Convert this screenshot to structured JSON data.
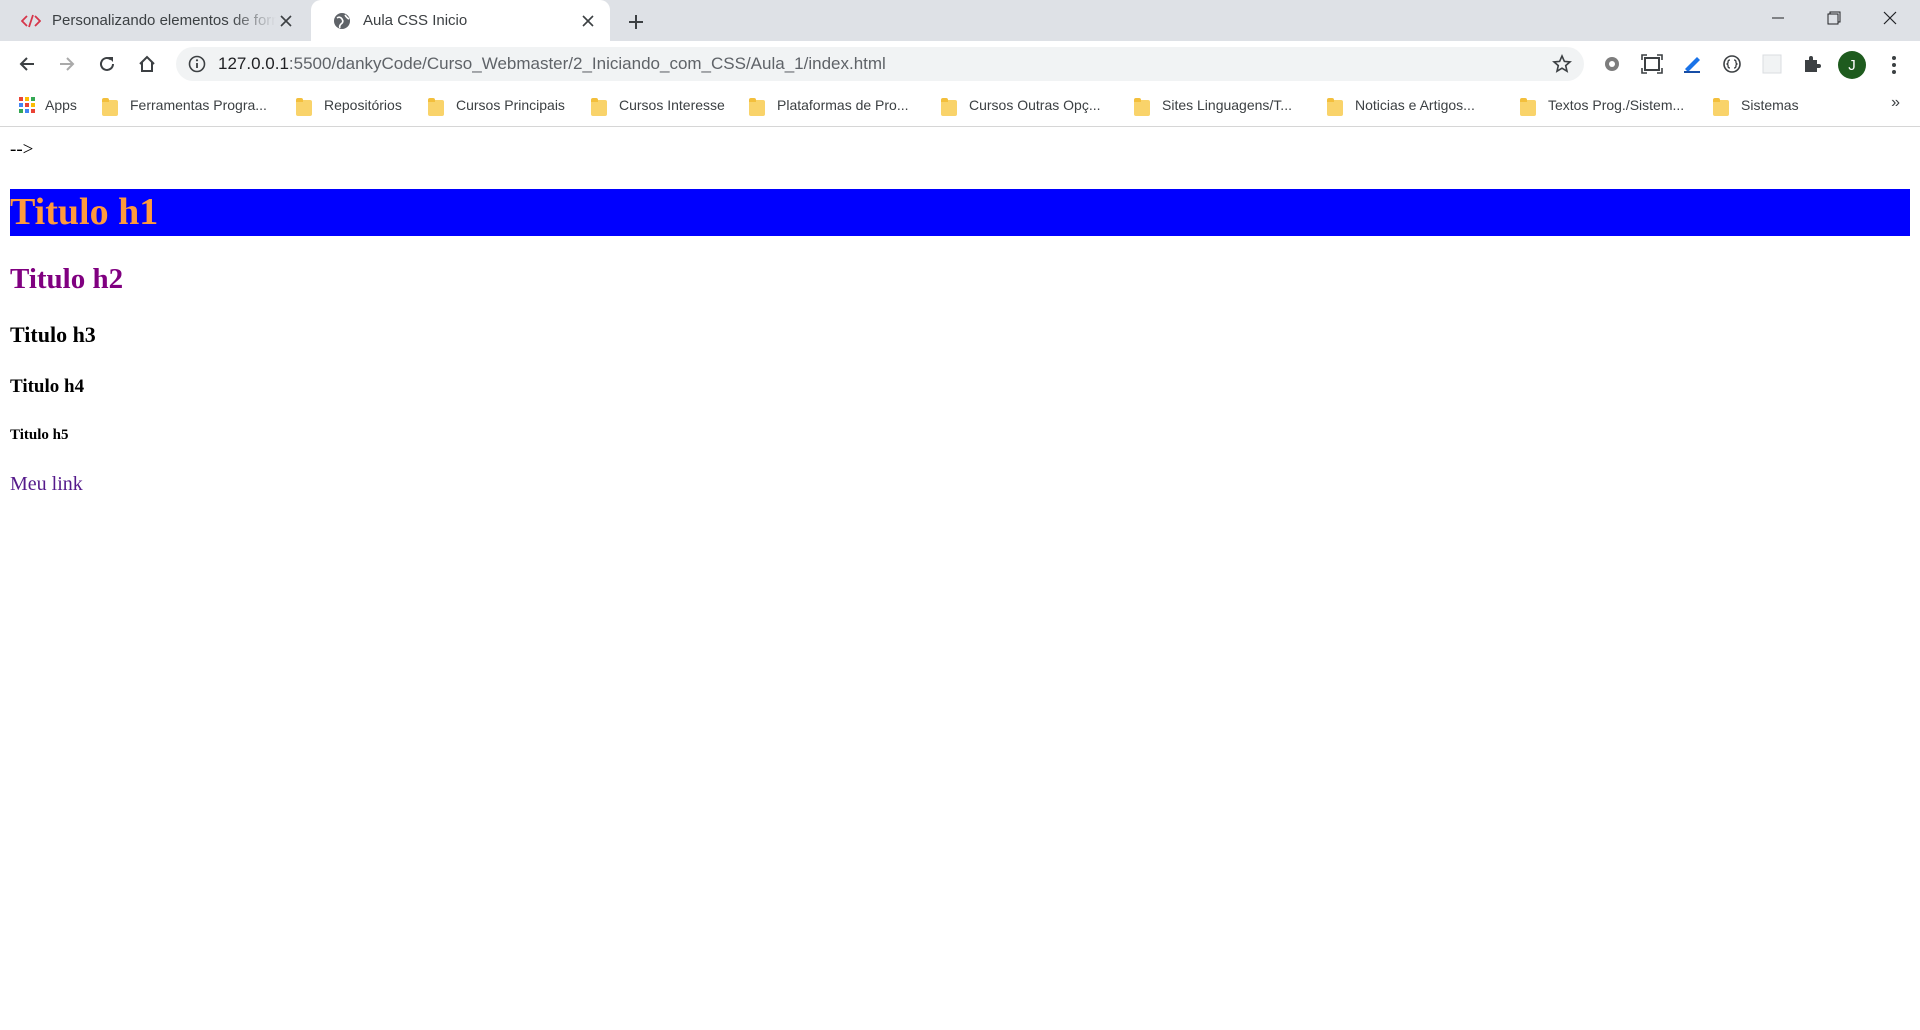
{
  "tabs": [
    {
      "title": "Personalizando elementos de formulário",
      "icon": "code-icon",
      "active": false
    },
    {
      "title": "Aula CSS Inicio",
      "icon": "globe-icon",
      "active": true
    }
  ],
  "toolbar": {
    "url_host": "127.0.0.1",
    "url_path": ":5500/dankyCode/Curso_Webmaster/2_Iniciando_com_CSS/Aula_1/index.html",
    "avatar_letter": "J"
  },
  "bookmarks": {
    "apps_label": "Apps",
    "items": [
      "Ferramentas Progra...",
      "Repositórios",
      "Cursos Principais",
      "Cursos Interesse",
      "Plataformas de Pro...",
      "Cursos Outras Opç...",
      "Sites Linguagens/T...",
      "Noticias e Artigos...",
      "Textos Prog./Sistem...",
      "Sistemas"
    ],
    "overflow": "»"
  },
  "page": {
    "stray_text": "-->",
    "h1": "Titulo h1",
    "h2": "Titulo h2",
    "h3": "Titulo h3",
    "h4": "Titulo h4",
    "h5": "Titulo h5",
    "link": "Meu link"
  },
  "colors": {
    "h1_background": "#0000ff",
    "h1_text": "#ff9a3c",
    "h2_text": "#800080",
    "link": "#551a8b",
    "tabstrip": "#dee1e6",
    "avatar": "#1e5b1e"
  }
}
